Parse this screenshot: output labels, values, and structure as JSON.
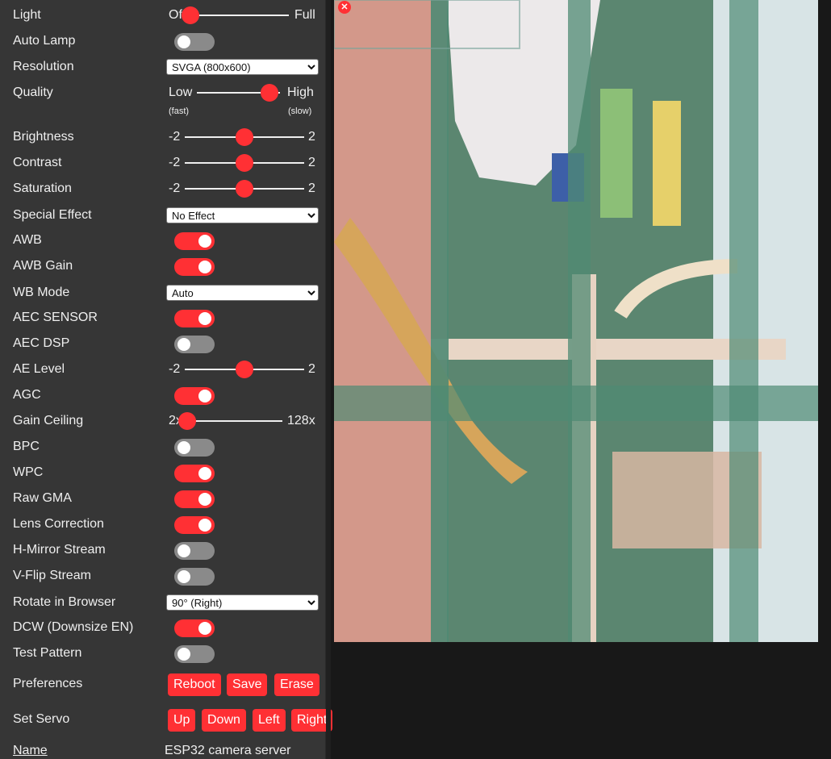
{
  "controls": {
    "light": {
      "label": "Light",
      "min": "Off",
      "max": "Full",
      "value": 0.0
    },
    "auto_lamp": {
      "label": "Auto Lamp",
      "on": false
    },
    "resolution": {
      "label": "Resolution",
      "selected": "SVGA (800x600)"
    },
    "quality": {
      "label": "Quality",
      "min": "Low",
      "max": "High",
      "min_sub": "(fast)",
      "max_sub": "(slow)",
      "value": 0.87
    },
    "brightness": {
      "label": "Brightness",
      "min": "-2",
      "max": "2",
      "value": 0.5
    },
    "contrast": {
      "label": "Contrast",
      "min": "-2",
      "max": "2",
      "value": 0.5
    },
    "saturation": {
      "label": "Saturation",
      "min": "-2",
      "max": "2",
      "value": 0.5
    },
    "special_effect": {
      "label": "Special Effect",
      "selected": "No Effect"
    },
    "awb": {
      "label": "AWB",
      "on": true
    },
    "awb_gain": {
      "label": "AWB Gain",
      "on": true
    },
    "wb_mode": {
      "label": "WB Mode",
      "selected": "Auto"
    },
    "aec_sensor": {
      "label": "AEC SENSOR",
      "on": true
    },
    "aec_dsp": {
      "label": "AEC DSP",
      "on": false
    },
    "ae_level": {
      "label": "AE Level",
      "min": "-2",
      "max": "2",
      "value": 0.5
    },
    "agc": {
      "label": "AGC",
      "on": true
    },
    "gain_ceiling": {
      "label": "Gain Ceiling",
      "min": "2x",
      "max": "128x",
      "value": 0.0
    },
    "bpc": {
      "label": "BPC",
      "on": false
    },
    "wpc": {
      "label": "WPC",
      "on": true
    },
    "raw_gma": {
      "label": "Raw GMA",
      "on": true
    },
    "lens_correction": {
      "label": "Lens Correction",
      "on": true
    },
    "h_mirror": {
      "label": "H-Mirror Stream",
      "on": false
    },
    "v_flip": {
      "label": "V-Flip Stream",
      "on": false
    },
    "rotate": {
      "label": "Rotate in Browser",
      "selected": "90° (Right)"
    },
    "dcw": {
      "label": "DCW (Downsize EN)",
      "on": true
    },
    "test_pattern": {
      "label": "Test Pattern",
      "on": false
    }
  },
  "preferences": {
    "label": "Preferences",
    "buttons": [
      "Reboot",
      "Save",
      "Erase"
    ]
  },
  "servo": {
    "label": "Set Servo",
    "buttons": [
      "Up",
      "Down",
      "Left",
      "Right"
    ]
  },
  "name": {
    "label": "Name",
    "value": "ESP32 camera server"
  },
  "stream": {
    "close_glyph": "✕"
  },
  "colors": {
    "accent": "#ff3034",
    "panel": "#363636",
    "background": "#181818",
    "toggle_off": "#8a8a8a"
  }
}
